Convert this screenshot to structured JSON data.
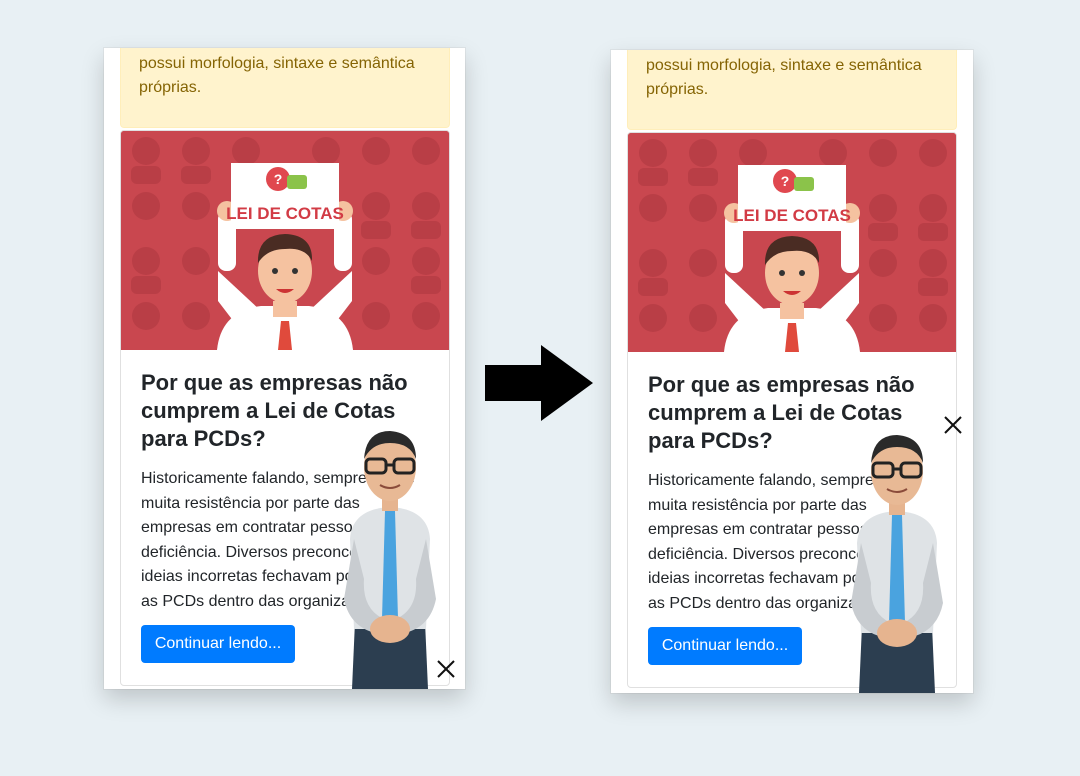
{
  "alert": {
    "line1": "possui morfologia, sintaxe e semântica",
    "line2": "próprias."
  },
  "card": {
    "image_sign_text": "LEI DE COTAS",
    "title": "Por que as empresas não cumprem a Lei de Cotas para PCDs?",
    "body": "Historicamente falando, sempre houve muita resistência por parte das empresas em contratar pessoas com deficiência. Diversos preconceitos e ideias incorretas fechavam portas para as PCDs dentro das organizações.",
    "button": "Continuar lendo..."
  },
  "colors": {
    "page_bg": "#e8f0f4",
    "alert_bg": "#fff3cd",
    "alert_text": "#856404",
    "image_bg": "#c9474f",
    "button_bg": "#007bff"
  },
  "icons": {
    "close": "close-icon",
    "arrow": "arrow-right-icon",
    "interpreter": "sign-language-avatar"
  }
}
